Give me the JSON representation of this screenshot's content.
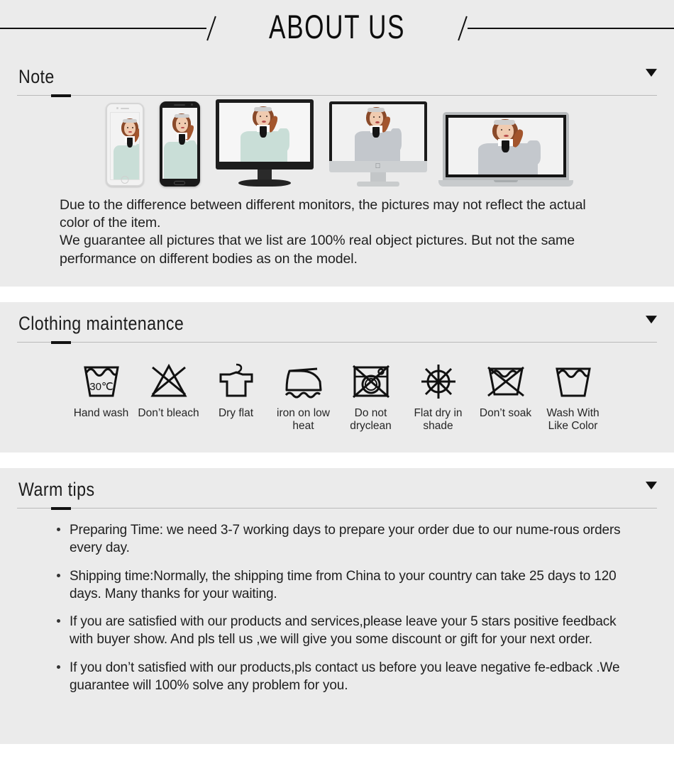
{
  "banner": {
    "title": "ABOUT US"
  },
  "sections": [
    {
      "id": "note",
      "heading": "Note",
      "caret": "chevron-down-icon",
      "paragraphs": [
        "Due to the difference between different monitors, the pictures may not reflect the actual color of the item.",
        "We guarantee all pictures that we list are 100% real object pictures. But not the same performance on different bodies as on the model."
      ],
      "devices": [
        {
          "name": "iphone",
          "label": "white-smartphone"
        },
        {
          "name": "android",
          "label": "black-smartphone"
        },
        {
          "name": "monitor",
          "label": "desktop-monitor"
        },
        {
          "name": "imac",
          "label": "all-in-one-desktop"
        },
        {
          "name": "laptop",
          "label": "laptop-computer"
        }
      ]
    },
    {
      "id": "clothing-maintenance",
      "heading": "Clothing maintenance",
      "caret": "chevron-down-icon"
    },
    {
      "id": "warm-tips",
      "heading": "Warm tips",
      "caret": "chevron-down-icon"
    }
  ],
  "care_icons": [
    {
      "icon": "hand-wash-icon",
      "temperature": "30",
      "unit": "℃",
      "label": "Hand wash"
    },
    {
      "icon": "do-not-bleach-icon",
      "label": "Don’t bleach"
    },
    {
      "icon": "dry-flat-icon",
      "label": "Dry flat"
    },
    {
      "icon": "iron-low-heat-icon",
      "label": "iron on low heat"
    },
    {
      "icon": "do-not-dryclean-icon",
      "label": "Do not dryclean"
    },
    {
      "icon": "flat-dry-in-shade-icon",
      "label": "Flat dry in shade"
    },
    {
      "icon": "do-not-soak-icon",
      "label": "Don’t soak"
    },
    {
      "icon": "wash-with-like-color-icon",
      "label": "Wash With Like Color"
    }
  ],
  "tips": [
    "Preparing Time: we need 3-7 working days to prepare your order due to our nume-rous orders every day.",
    "Shipping time:Normally, the shipping time from China to your country can take 25 days to 120 days. Many thanks for your waiting.",
    "If you are satisfied with our products and services,please leave your 5 stars positive feedback with buyer show. And pls tell us ,we will give you some discount or gift for your next order.",
    "If you don’t satisfied with our products,pls contact us before you leave negative fe-edback .We guarantee will 100% solve any problem for you."
  ],
  "colors": {
    "section_bg": "#ebebeb",
    "page_bg": "#ffffff",
    "text": "#1f1f1f",
    "rule": "#b9b9b9",
    "accent": "#111111"
  }
}
